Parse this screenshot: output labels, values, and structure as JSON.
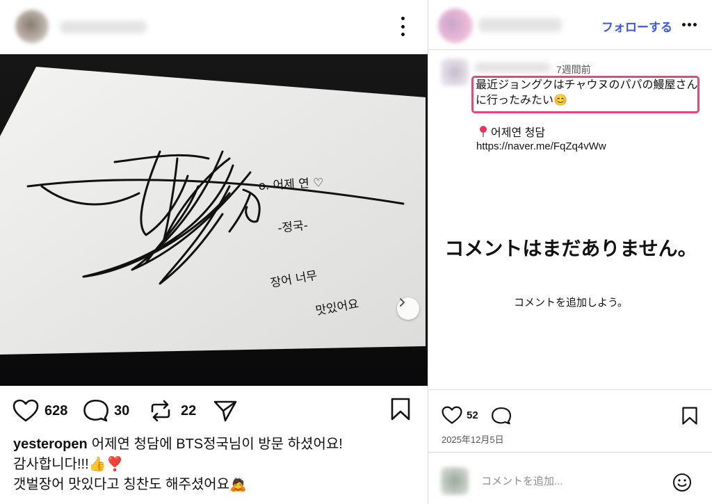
{
  "post": {
    "like_count": "628",
    "comment_count": "30",
    "repost_count": "22",
    "caption_user": "yesteropen",
    "caption_line1": "어제연 청담에 BTS정국님이 방문 하셨어요!",
    "caption_line2": "감사합니다!!!👍❣️",
    "caption_line3": "갯벌장어 맛있다고 칭찬도 해주셨어요🙇"
  },
  "photo": {
    "autograph_text_1": "o. 어제 연 ♡",
    "autograph_text_2": "-정국-",
    "autograph_text_3": "장어 너무",
    "autograph_text_4": "맛있어요"
  },
  "side": {
    "follow_label": "フォローする",
    "time_ago": "7週間前",
    "comment_text": "最近ジョングクはチャウヌのパパの鰻屋さんに行ったみたい😊",
    "location_text": "어제연 청담",
    "url_text": "https://naver.me/FqZq4vWw",
    "no_comments_title": "コメントはまだありません。",
    "no_comments_sub": "コメントを追加しよう。",
    "like_count": "52",
    "date": "2025年12月5日",
    "comment_placeholder": "コメントを追加..."
  },
  "icons": {
    "like": "heart-icon",
    "comment": "speech-bubble-icon",
    "repost": "repost-icon",
    "share": "paper-plane-icon",
    "save": "bookmark-icon",
    "pin": "map-pin-icon",
    "emoji": "smiley-icon",
    "next": "chevron-right-icon",
    "more": "more-horizontal-icon",
    "menu": "more-vertical-icon"
  },
  "colors": {
    "follow": "#3b57e8",
    "highlight_border": "#e8467c",
    "pin": "#e5365a"
  }
}
